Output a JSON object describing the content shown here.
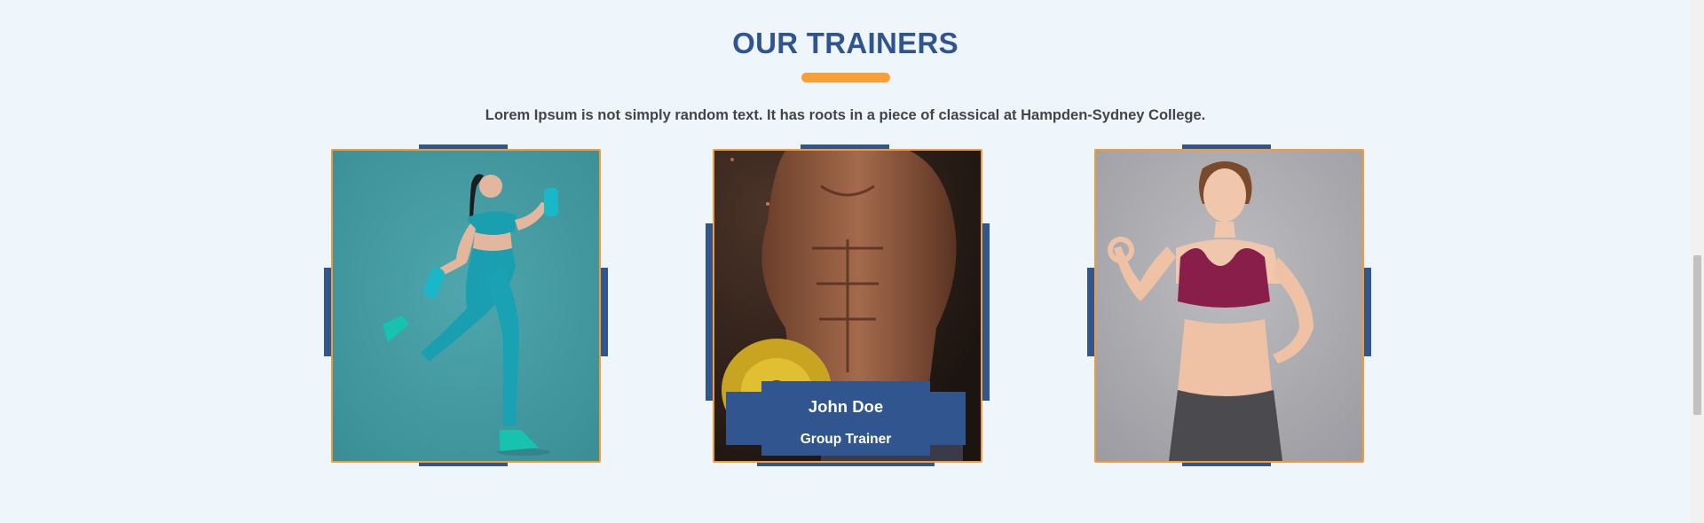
{
  "section": {
    "title": "OUR TRAINERS",
    "subtitle": "Lorem Ipsum is not simply random text. It has roots in a piece of classical at Hampden-Sydney College."
  },
  "colors": {
    "accent_blue": "#31568f",
    "accent_orange": "#f39b34",
    "background": "#eef6fc"
  },
  "trainers": [
    {
      "photo": "woman-running-with-dumbbells"
    },
    {
      "photo": "muscular-man-with-weight-plate",
      "name": "John Doe",
      "role": "Group Trainer"
    },
    {
      "photo": "smiling-woman-ok-gesture"
    }
  ]
}
